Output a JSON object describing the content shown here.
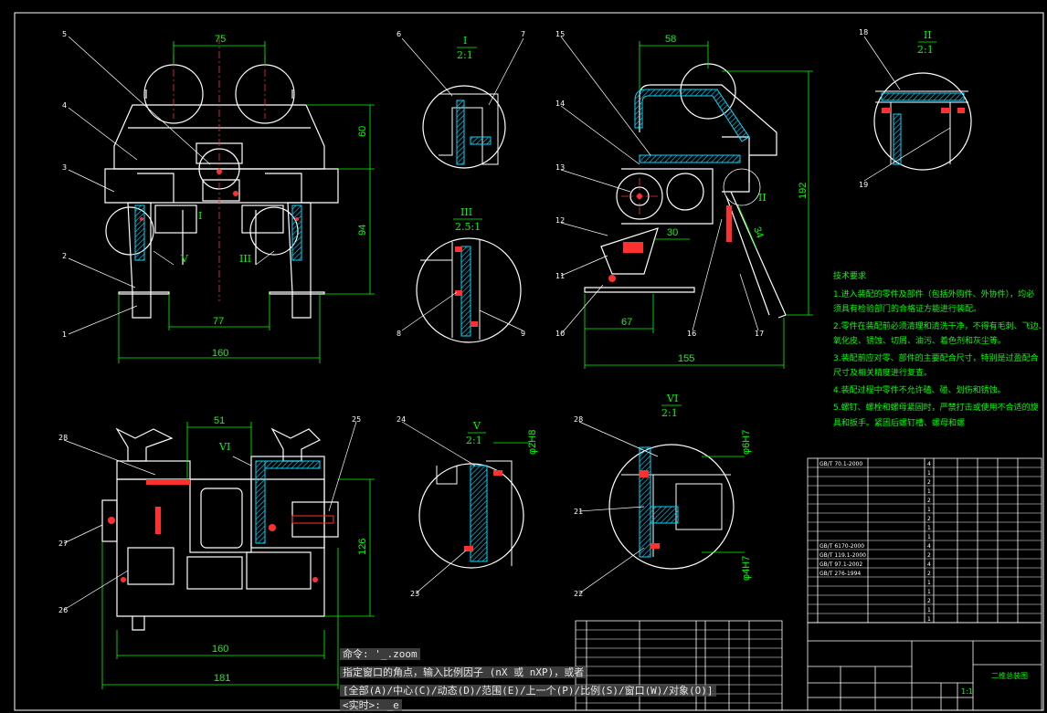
{
  "drawing": {
    "dimensions": {
      "d75": "75",
      "d60": "60",
      "d94": "94",
      "d77": "77",
      "d160a": "160",
      "d58": "58",
      "d192": "192",
      "d30": "30",
      "d34": "34",
      "d67": "67",
      "d155": "155",
      "d51": "51",
      "d126": "126",
      "d160b": "160",
      "d181": "181",
      "d2h8": "φ2H8",
      "d6h7": "φ6H7",
      "d4h7": "φ4H7"
    },
    "detail_views": {
      "I": {
        "label": "I",
        "scale": "2:1"
      },
      "II": {
        "label": "II",
        "scale": "2:1"
      },
      "III": {
        "label": "III",
        "scale": "2.5:1"
      },
      "V": {
        "label": "V",
        "scale": "2:1"
      },
      "VI": {
        "label": "VI",
        "scale": "2:1"
      }
    },
    "view_marks": {
      "I": "I",
      "V": "V",
      "III": "III",
      "II": "II",
      "VI": "VI"
    },
    "callouts": [
      "1",
      "2",
      "3",
      "4",
      "5",
      "6",
      "7",
      "8",
      "9",
      "10",
      "11",
      "12",
      "13",
      "14",
      "15",
      "16",
      "17",
      "18",
      "19",
      "21",
      "22",
      "23",
      "24",
      "25",
      "26",
      "27",
      "28"
    ],
    "tech_requirements": {
      "title": "技术要求",
      "lines": [
        "1.进入装配的零件及部件（包括外购件、外协件），均必",
        "须具有检验部门的合格证方能进行装配。",
        "2.零件在装配前必须清理和清洗干净，不得有毛刺、飞边、",
        "氧化皮、锈蚀、切屑、油污、着色剂和灰尘等。",
        "3.装配前应对零、部件的主要配合尺寸，特别是过盈配合",
        "尺寸及相关精度进行复查。",
        "4.装配过程中零件不允许磕、碰、划伤和锈蚀。",
        "5.螺钉、螺栓和螺母紧固时，严禁打击或使用不合适的旋",
        "具和扳手。紧固后螺钉槽、螺母和螺"
      ]
    },
    "bom_rows": [
      {
        "code": "GB/T 70.1-2000",
        "qty": "4"
      },
      {
        "code": "",
        "qty": "1"
      },
      {
        "code": "",
        "qty": "2"
      },
      {
        "code": "",
        "qty": "1"
      },
      {
        "code": "",
        "qty": "2"
      },
      {
        "code": "",
        "qty": "1"
      },
      {
        "code": "",
        "qty": "2"
      },
      {
        "code": "",
        "qty": "1"
      },
      {
        "code": "",
        "qty": "1"
      },
      {
        "code": "GB/T 6170-2000",
        "qty": "4"
      },
      {
        "code": "GB/T 119.1-2000",
        "qty": "2"
      },
      {
        "code": "GB/T 97.1-2002",
        "qty": "4"
      },
      {
        "code": "GB/T 276-1994",
        "qty": "2"
      },
      {
        "code": "",
        "qty": "1"
      },
      {
        "code": "",
        "qty": "1"
      },
      {
        "code": "",
        "qty": "2"
      },
      {
        "code": "",
        "qty": "1"
      },
      {
        "code": "",
        "qty": "1"
      }
    ],
    "title_block": {
      "name": "二维总装图",
      "scale": "1:1"
    }
  },
  "command_window": {
    "history_1": "命令: '_.zoom",
    "history_2": "指定窗口的角点，输入比例因子 (nX 或 nXP)，或者",
    "options": "[全部(A)/中心(C)/动态(D)/范围(E)/上一个(P)/比例(S)/窗口(W)/对象(O)]",
    "prompt": "<实时>: _e"
  },
  "colors": {
    "background": "#000000",
    "dimension": "#00ff00",
    "outline": "#ffffff",
    "hatch": "#00d8ff",
    "center": "#ff3030"
  }
}
